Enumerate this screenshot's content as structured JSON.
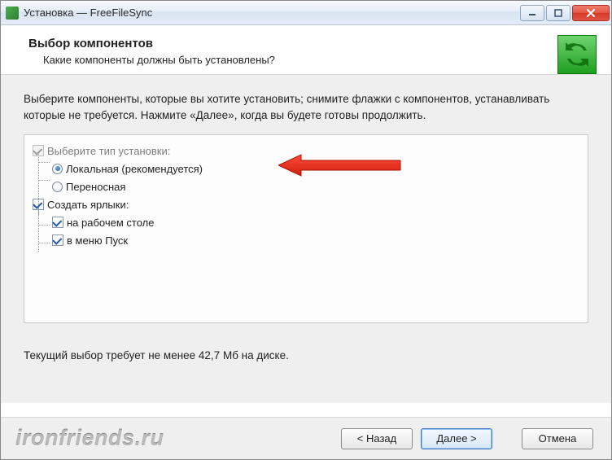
{
  "window": {
    "title": "Установка — FreeFileSync"
  },
  "header": {
    "title": "Выбор компонентов",
    "subtitle": "Какие компоненты должны быть установлены?"
  },
  "main": {
    "instructions": "Выберите компоненты, которые вы хотите установить; снимите флажки с компонентов, устанавливать которые не требуется. Нажмите «Далее», когда вы будете готовы продолжить.",
    "install_type_label": "Выберите тип установки:",
    "options": {
      "local": "Локальная (рекомендуется)",
      "portable": "Переносная"
    },
    "shortcuts_label": "Создать ярлыки:",
    "shortcuts": {
      "desktop": "на рабочем столе",
      "startmenu": "в меню Пуск"
    },
    "disk_req": "Текущий выбор требует не менее 42,7 Мб на диске."
  },
  "buttons": {
    "back": "< Назад",
    "next": "Далее >",
    "cancel": "Отмена"
  },
  "watermark": "ironfriends.ru"
}
